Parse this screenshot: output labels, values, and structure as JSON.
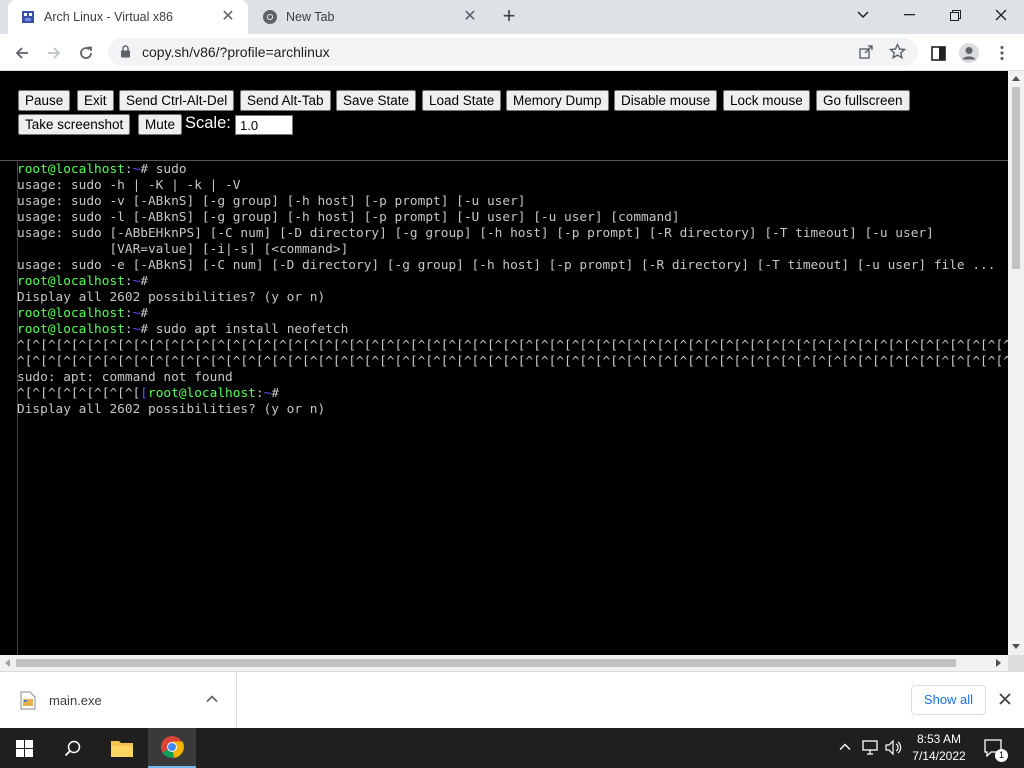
{
  "browser": {
    "tabs": [
      {
        "title": "Arch Linux - Virtual x86",
        "active": true
      },
      {
        "title": "New Tab",
        "active": false
      }
    ],
    "address": {
      "url": "copy.sh/v86/?profile=archlinux"
    }
  },
  "emulator": {
    "buttons": [
      "Pause",
      "Exit",
      "Send Ctrl-Alt-Del",
      "Send Alt-Tab",
      "Save State",
      "Load State",
      "Memory Dump",
      "Disable mouse",
      "Lock mouse",
      "Go fullscreen",
      "Take screenshot",
      "Mute"
    ],
    "scale_label": "Scale:",
    "scale_value": "1.0"
  },
  "terminal": {
    "prompt_user": "root@localhost",
    "prompt_path": "~",
    "lines": [
      {
        "prompt": true,
        "text": "# sudo"
      },
      {
        "prompt": false,
        "text": "usage: sudo -h | -K | -k | -V"
      },
      {
        "prompt": false,
        "text": "usage: sudo -v [-ABknS] [-g group] [-h host] [-p prompt] [-u user]"
      },
      {
        "prompt": false,
        "text": "usage: sudo -l [-ABknS] [-g group] [-h host] [-p prompt] [-U user] [-u user] [command]"
      },
      {
        "prompt": false,
        "text": "usage: sudo [-ABbEHknPS] [-C num] [-D directory] [-g group] [-h host] [-p prompt] [-R directory] [-T timeout] [-u user]"
      },
      {
        "prompt": false,
        "text": "            [VAR=value] [-i|-s] [<command>]"
      },
      {
        "prompt": false,
        "text": "usage: sudo -e [-ABknS] [-C num] [-D directory] [-g group] [-h host] [-p prompt] [-R directory] [-T timeout] [-u user] file ..."
      },
      {
        "prompt": true,
        "text": "#"
      },
      {
        "prompt": false,
        "text": "Display all 2602 possibilities? (y or n)"
      },
      {
        "prompt": true,
        "text": "#"
      },
      {
        "prompt": true,
        "text": "# sudo apt install neofetch"
      },
      {
        "prompt": false,
        "text": "^[^[^[^[^[^[^[^[^[^[^[^[^[^[^[^[^[^[^[^[^[^[^[^[^[^[^[^[^[^[^[^[^[^[^[^[^[^[^[^[^[^[^[^[^[^[^[^[^[^[^[^[^[^[^[^[^[^[^[^[^[^[^[^[^["
      },
      {
        "prompt": false,
        "text": "^[^[^[^[^[^[^[^[^[^[^[^[^[^[^[^[^[^[^[^[^[^[^[^[^[^[^[^[^[^[^[^[^[^[^[^[^[^[^[^[^[^[^[^[^[^[^[^[^[^[^[^[^[^[^[^[^[^[^[^[^[^[^[^[^["
      },
      {
        "prompt": false,
        "text": "sudo: apt: command not found"
      },
      {
        "prompt": "inline",
        "prefix": "^[^[^[^[^[^[^[^[",
        "text": "#"
      },
      {
        "prompt": false,
        "text": "Display all 2602 possibilities? (y or n)"
      }
    ]
  },
  "downloads": {
    "file_name": "main.exe",
    "show_all_label": "Show all"
  },
  "taskbar": {
    "time": "8:53 AM",
    "date": "7/14/2022",
    "notification_count": "1"
  },
  "colors": {
    "prompt_green": "#54ff54",
    "prompt_blue": "#5454ff",
    "terminal_text": "#c6c6c6",
    "link_blue": "#1a73e8"
  }
}
